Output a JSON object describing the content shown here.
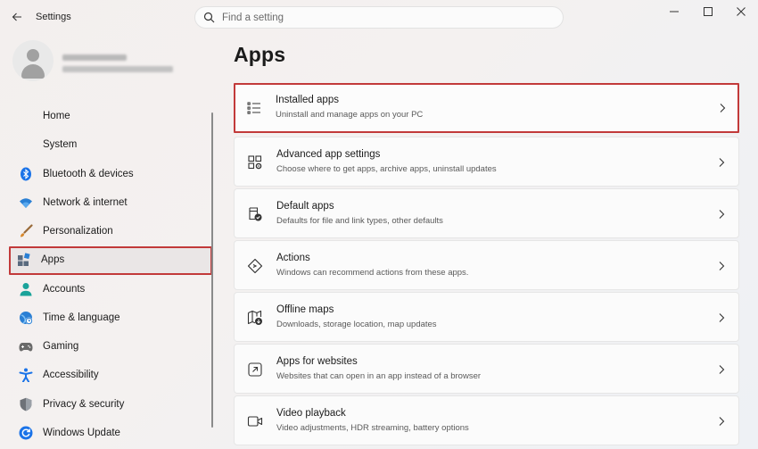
{
  "window": {
    "app_title": "Settings"
  },
  "search": {
    "placeholder": "Find a setting"
  },
  "sidebar": {
    "items": [
      {
        "label": "Home",
        "icon": "home-icon"
      },
      {
        "label": "System",
        "icon": "system-icon"
      },
      {
        "label": "Bluetooth & devices",
        "icon": "bluetooth-icon"
      },
      {
        "label": "Network & internet",
        "icon": "wifi-icon"
      },
      {
        "label": "Personalization",
        "icon": "brush-icon"
      },
      {
        "label": "Apps",
        "icon": "apps-icon",
        "selected": true
      },
      {
        "label": "Accounts",
        "icon": "person-icon"
      },
      {
        "label": "Time & language",
        "icon": "globe-clock-icon"
      },
      {
        "label": "Gaming",
        "icon": "gamepad-icon"
      },
      {
        "label": "Accessibility",
        "icon": "accessibility-icon"
      },
      {
        "label": "Privacy & security",
        "icon": "shield-icon"
      },
      {
        "label": "Windows Update",
        "icon": "update-icon"
      }
    ]
  },
  "main": {
    "title": "Apps",
    "cards": [
      {
        "title": "Installed apps",
        "subtitle": "Uninstall and manage apps on your PC",
        "icon": "list-icon",
        "highlighted": true
      },
      {
        "title": "Advanced app settings",
        "subtitle": "Choose where to get apps, archive apps, uninstall updates",
        "icon": "app-settings-icon"
      },
      {
        "title": "Default apps",
        "subtitle": "Defaults for file and link types, other defaults",
        "icon": "default-apps-icon"
      },
      {
        "title": "Actions",
        "subtitle": "Windows can recommend actions from these apps.",
        "icon": "actions-icon"
      },
      {
        "title": "Offline maps",
        "subtitle": "Downloads, storage location, map updates",
        "icon": "map-download-icon"
      },
      {
        "title": "Apps for websites",
        "subtitle": "Websites that can open in an app instead of a browser",
        "icon": "open-link-icon"
      },
      {
        "title": "Video playback",
        "subtitle": "Video adjustments, HDR streaming, battery options",
        "icon": "video-icon"
      }
    ]
  },
  "colors": {
    "highlight_border": "#c23a3a",
    "accent": "#0067c0"
  }
}
